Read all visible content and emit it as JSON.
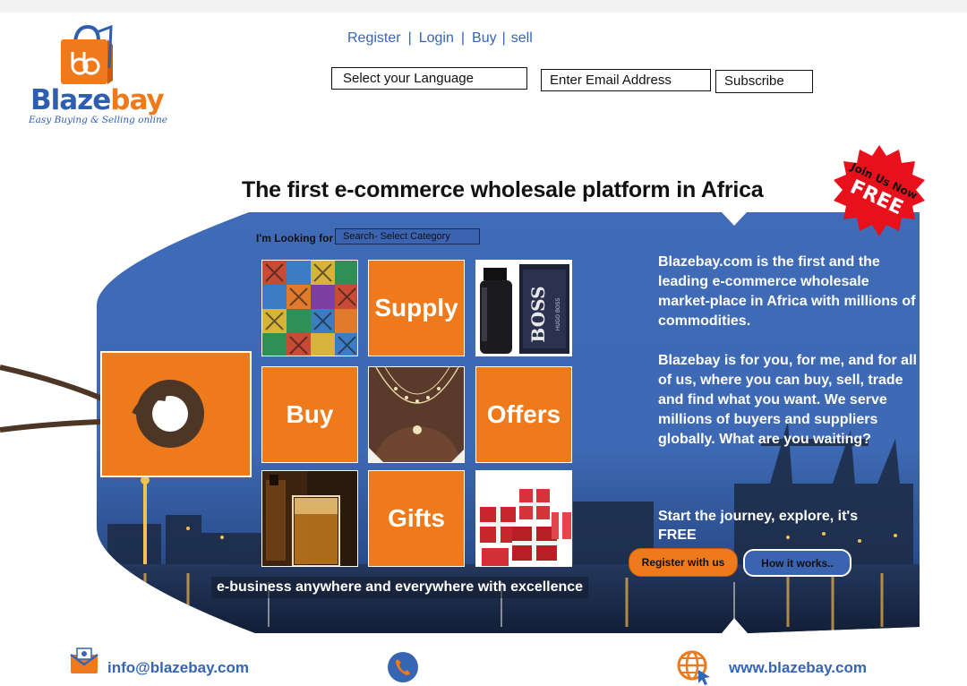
{
  "brand": {
    "name_part1": "Blaze",
    "name_part2": "bay",
    "tagline": "Easy Buying & Selling online",
    "monogram": "bb",
    "colors": {
      "orange": "#ef7a1b",
      "blue": "#3565b3",
      "banner_blue": "#3f6bb7"
    }
  },
  "nav": {
    "register": "Register",
    "login": "Login",
    "buy": "Buy",
    "sell": "sell",
    "sep": "|"
  },
  "language_select": {
    "value": "Select your Language"
  },
  "newsletter": {
    "placeholder": "Enter Email Address",
    "button": "Subscribe"
  },
  "headline": "The first e-commerce wholesale platform in Africa",
  "promo_badge": {
    "line1": "Join Us Now",
    "line2": "FREE"
  },
  "search": {
    "label": "I'm Looking for",
    "value": "Search- Select Category"
  },
  "tiles": {
    "supply": "Supply",
    "buy": "Buy",
    "offers": "Offers",
    "gifts": "Gifts",
    "perfume_brand": "BOSS",
    "perfume_sub": "HUGO BOSS"
  },
  "description": {
    "p1": "Blazebay.com is the first and the leading e-commerce wholesale  market-place in Africa with millions of commodities.",
    "p2": "Blazebay is for you, for me, and for all of us, where you can buy, sell, trade and find what you want.  We serve millions of buyers and suppliers globally. What are you waiting?"
  },
  "cta": {
    "journey": "Start the journey, explore, it's FREE",
    "register": "Register with us",
    "how": "How it works.."
  },
  "slogan": "e-business anywhere and everywhere with excellence",
  "footer": {
    "email": "info@blazebay.com",
    "website": "www.blazebay.com",
    "icons": [
      "mail-icon",
      "phone-icon",
      "globe-cursor-icon"
    ]
  }
}
